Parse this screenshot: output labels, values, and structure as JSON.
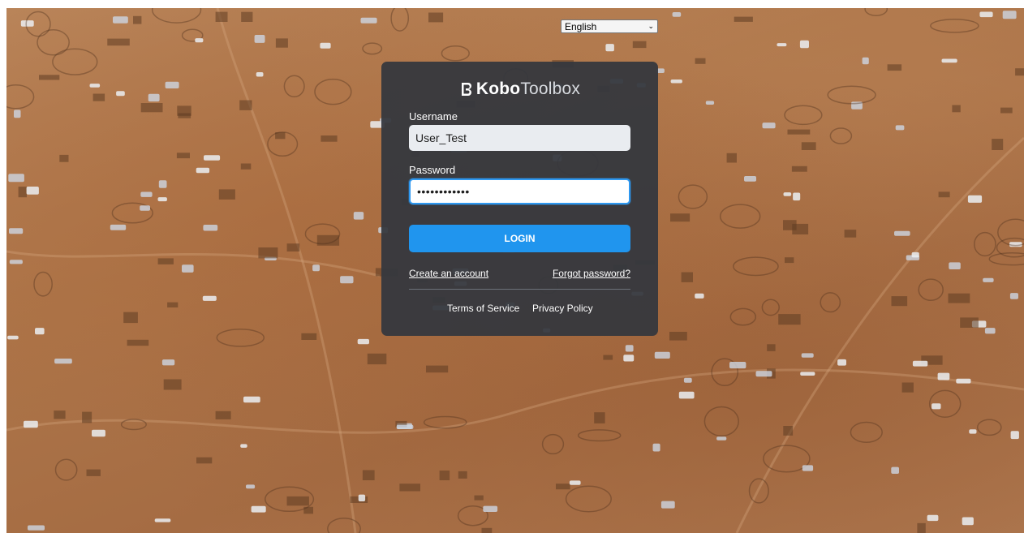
{
  "language": {
    "selected": "English"
  },
  "logo": {
    "text_bold": "Kobo",
    "text_light": "Toolbox"
  },
  "form": {
    "username_label": "Username",
    "username_value": "User_Test",
    "password_label": "Password",
    "password_masked": "••••••••••••",
    "login_label": "LOGIN"
  },
  "links": {
    "create_account": "Create an account",
    "forgot_password": "Forgot password?",
    "terms": "Terms of Service",
    "privacy": "Privacy Policy"
  },
  "colors": {
    "card_bg": "#34373e",
    "accent": "#2095ee",
    "input_bg": "#e9ecf0"
  },
  "icons": {
    "logo": "kobotoolbox-logo-icon",
    "select_arrow": "chevron-down-icon"
  }
}
